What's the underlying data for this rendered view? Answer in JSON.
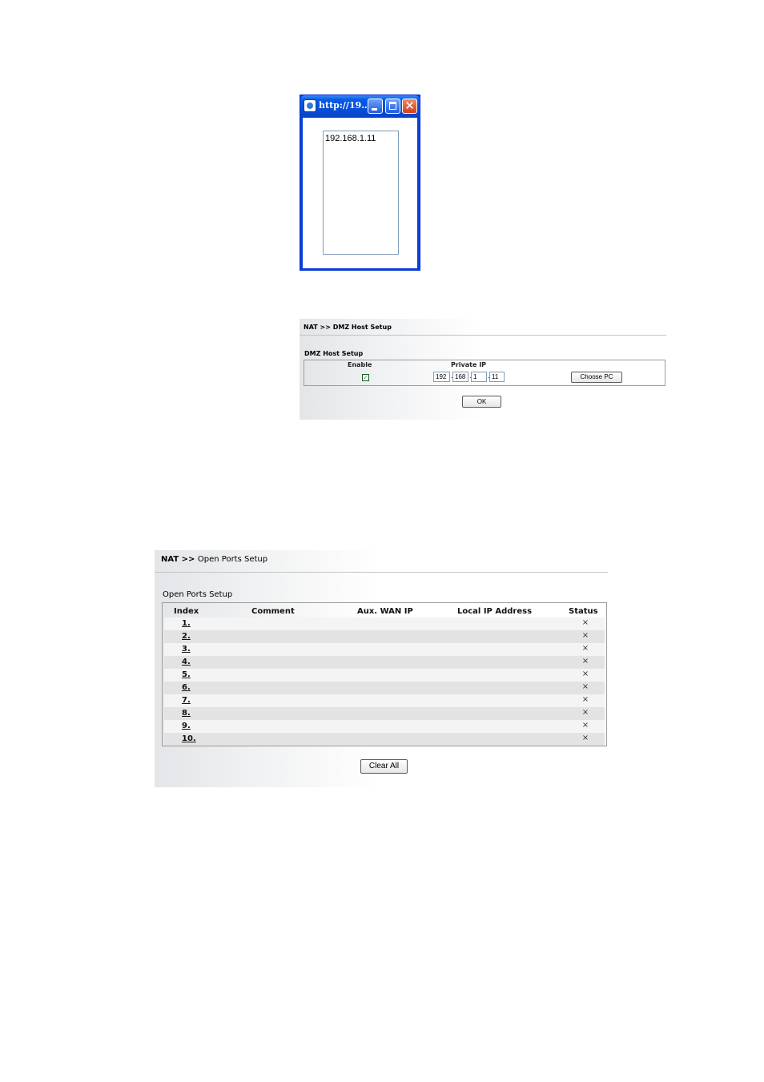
{
  "popup": {
    "title": "http://19…",
    "list_items": [
      "192.168.1.11"
    ]
  },
  "dmz": {
    "breadcrumb_root": "NAT",
    "breadcrumb_sep": ">>",
    "breadcrumb_current": "DMZ Host Setup",
    "section_title": "DMZ Host Setup",
    "col_enable": "Enable",
    "col_private_ip": "Private IP",
    "enable_checked": true,
    "checkmark": "✓",
    "ip": [
      "192",
      "168",
      "1",
      "11"
    ],
    "choose_pc_label": "Choose PC",
    "ok_label": "OK"
  },
  "ports": {
    "breadcrumb_root": "NAT",
    "breadcrumb_sep": ">>",
    "breadcrumb_current": "Open Ports Setup",
    "section_title": "Open Ports Setup",
    "headers": {
      "index": "Index",
      "comment": "Comment",
      "aux_wan_ip": "Aux. WAN IP",
      "local_ip": "Local IP Address",
      "status": "Status"
    },
    "rows": [
      {
        "index": "1.",
        "status": "×"
      },
      {
        "index": "2.",
        "status": "×"
      },
      {
        "index": "3.",
        "status": "×"
      },
      {
        "index": "4.",
        "status": "×"
      },
      {
        "index": "5.",
        "status": "×"
      },
      {
        "index": "6.",
        "status": "×"
      },
      {
        "index": "7.",
        "status": "×"
      },
      {
        "index": "8.",
        "status": "×"
      },
      {
        "index": "9.",
        "status": "×"
      },
      {
        "index": "10.",
        "status": "×"
      }
    ],
    "clear_all_label": "Clear All"
  },
  "colors": {
    "titlebar_blue": "#0a5ae8",
    "close_red": "#d3401a",
    "check_green": "#2a9a3a",
    "row_light": "#f4f4f4",
    "row_dark": "#e3e3e3"
  }
}
